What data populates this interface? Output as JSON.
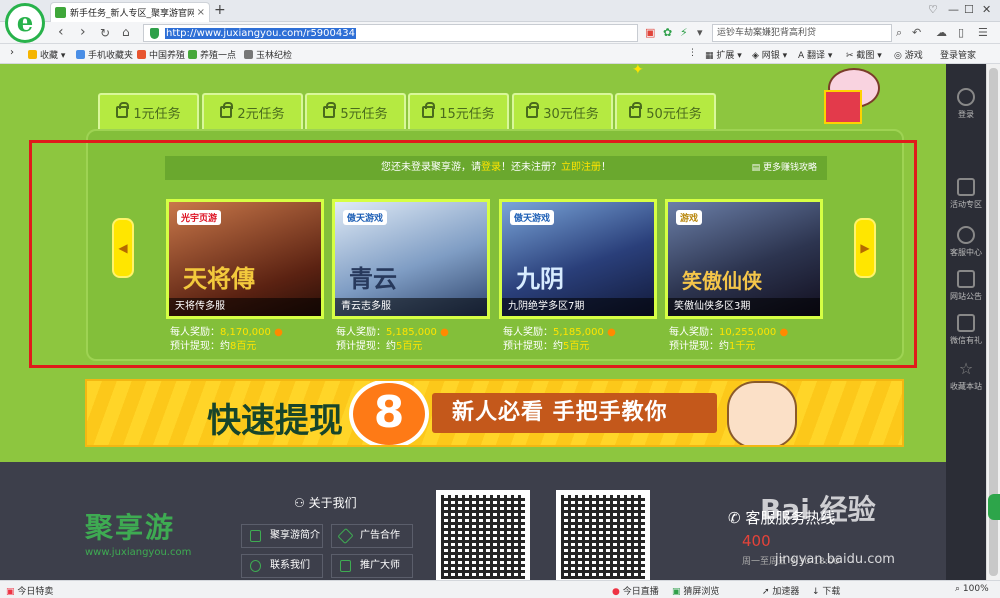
{
  "browser": {
    "logo": "e",
    "tab_title": "新手任务_新人专区_聚享游官网",
    "new_tab": "+",
    "close_tab": "×",
    "url": "http://www.juxiangyou.com/r5900434",
    "search_text": "运钞车劫案嫌犯背高利贷",
    "win_controls": [
      "♡",
      "—",
      "☐",
      "✕"
    ]
  },
  "bookmarks": {
    "items": [
      {
        "label": "收藏",
        "color": "#f5b400"
      },
      {
        "label": "手机收藏夹",
        "color": "#4a8ee6"
      },
      {
        "label": "中国养殖",
        "color": "#e8542f"
      },
      {
        "label": "养殖一点",
        "color": "#46a83b"
      },
      {
        "label": "玉林纪检",
        "color": "#777777"
      }
    ],
    "right_items": [
      "扩展",
      "网银",
      "翻译",
      "截图",
      "游戏",
      "登录管家"
    ]
  },
  "task_tabs": [
    "1元任务",
    "2元任务",
    "5元任务",
    "15元任务",
    "30元任务",
    "50元任务"
  ],
  "notice": {
    "prefix": "您还未登录聚享游，请",
    "login": "登录",
    "middle": "！还未注册？",
    "register": "立即注册",
    "suffix": "！",
    "more": "更多赚钱攻略"
  },
  "games": [
    {
      "name": "天将传多服",
      "logo": "光宇页游",
      "art": "天将傳",
      "reward_label": "每人奖励：",
      "reward": "8,170,000",
      "est_label": "预计提现：约",
      "est": "8百元",
      "bg": "#7a2f1d"
    },
    {
      "name": "青云志多服",
      "logo": "傲天游戏",
      "art": "青云",
      "reward_label": "每人奖励：",
      "reward": "5,185,000",
      "est_label": "预计提现：约",
      "est": "5百元",
      "bg": "#6f8fb5"
    },
    {
      "name": "九阴绝学多区7期",
      "logo": "傲天游戏",
      "art": "九阴",
      "reward_label": "每人奖励：",
      "reward": "5,185,000",
      "est_label": "预计提现：约",
      "est": "5百元",
      "bg": "#2a3f7a"
    },
    {
      "name": "笑傲仙侠多区3期",
      "logo": "游戏",
      "art": "笑傲仙侠",
      "reward_label": "每人奖励：",
      "reward": "10,255,000",
      "est_label": "预计提现：约",
      "est": "1千元",
      "bg": "#2d3550"
    }
  ],
  "banner": {
    "t1": "快速提现",
    "amount": "8元",
    "t2": "新人必看 手把手教你"
  },
  "footer": {
    "brand": "聚享游",
    "url": "www.juxiangyou.com",
    "about": "关于我们",
    "links": [
      "聚享游简介",
      "广告合作",
      "联系我们",
      "推广大师"
    ],
    "hotline": "客服服务热线",
    "phone": "400",
    "hours": "周一至周五 9:30-18:00"
  },
  "sidebar": [
    "登录",
    "活动专区",
    "客服中心",
    "网站公告",
    "微信有礼",
    "收藏本站"
  ],
  "status": {
    "left": "今日特卖",
    "items": [
      "今日直播",
      "猜屏浏览",
      "加速器",
      "下载",
      "100%"
    ]
  },
  "watermark": {
    "main": "Bai 经验",
    "sub": "jingyan.baidu.com"
  },
  "colors": {
    "page_green": "#8dc63f",
    "highlight_red": "#e01b1b",
    "accent_yellow": "#ffe400"
  }
}
